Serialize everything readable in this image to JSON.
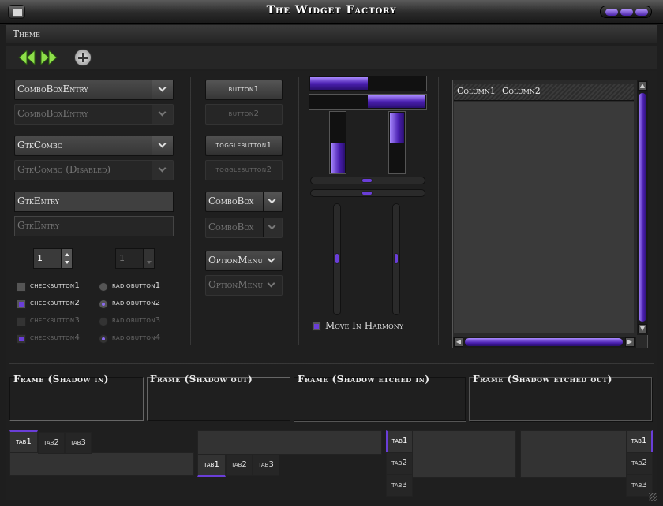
{
  "window": {
    "title": "The Widget Factory"
  },
  "menu": {
    "items": [
      "Theme"
    ]
  },
  "toolbar": {
    "back_icon": "rewind-icon",
    "forward_icon": "fast-forward-icon",
    "add_icon": "add-icon"
  },
  "combos": {
    "entry1": "ComboBoxEntry",
    "entry2": "ComboBoxEntry",
    "gtkcombo1": "GtkCombo",
    "gtkcombo2": "GtkCombo (Disabled)"
  },
  "entries": {
    "entry1": "GtkEntry",
    "entry2": "GtkEntry"
  },
  "spins": {
    "spin1": "1",
    "spin2": "1"
  },
  "checks": [
    "checkbutton1",
    "checkbutton2",
    "checkbutton3",
    "checkbutton4"
  ],
  "radios": [
    "radiobutton1",
    "radiobutton2",
    "radiobutton3",
    "radiobutton4"
  ],
  "buttons": {
    "button1": "button1",
    "button2": "button2",
    "toggle1": "togglebutton1",
    "toggle2": "togglebutton2",
    "combobox1": "ComboBox",
    "combobox2": "ComboBox",
    "option1": "OptionMenu",
    "option2": "OptionMenu"
  },
  "progress": {
    "h1": 0.5,
    "h2": 0.5,
    "v1": 0.5,
    "v2": 0.5
  },
  "scales": {
    "h1": 0.5,
    "h2": 0.5,
    "v1": 0.5,
    "v2": 0.5
  },
  "harmony": {
    "label": "Move In Harmony"
  },
  "tree": {
    "columns": [
      "Column1",
      "Column2"
    ]
  },
  "frames": [
    "Frame (Shadow in)",
    "Frame (Shadow out)",
    "Frame (Shadow etched in)",
    "Frame (Shadow etched out)"
  ],
  "notebooks": {
    "tabs": [
      "tab1",
      "tab2",
      "tab3"
    ]
  },
  "colors": {
    "accent": "#6a3ed8",
    "background": "#1f1f1f"
  }
}
